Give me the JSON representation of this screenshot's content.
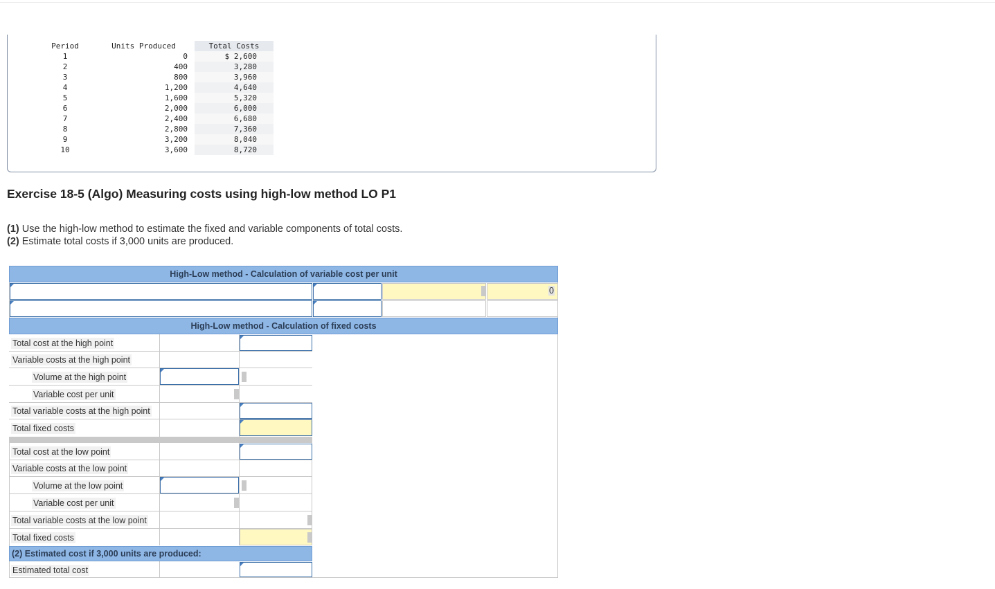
{
  "data_table": {
    "headers": [
      "Period",
      "Units Produced",
      "Total Costs"
    ],
    "rows": [
      [
        "1",
        "0",
        "$ 2,600"
      ],
      [
        "2",
        "400",
        "3,280"
      ],
      [
        "3",
        "800",
        "3,960"
      ],
      [
        "4",
        "1,200",
        "4,640"
      ],
      [
        "5",
        "1,600",
        "5,320"
      ],
      [
        "6",
        "2,000",
        "6,000"
      ],
      [
        "7",
        "2,400",
        "6,680"
      ],
      [
        "8",
        "2,800",
        "7,360"
      ],
      [
        "9",
        "3,200",
        "8,040"
      ],
      [
        "10",
        "3,600",
        "8,720"
      ]
    ]
  },
  "exercise": {
    "title": "Exercise 18-5 (Algo) Measuring costs using high-low method LO P1",
    "line1_num": "(1)",
    "line1_text": " Use the high-low method to estimate the fixed and variable components of total costs.",
    "line2_num": "(2)",
    "line2_text": " Estimate total costs if 3,000 units are produced."
  },
  "worksheet": {
    "variable_header": "High-Low method - Calculation of variable cost per unit",
    "variable_result": "0",
    "fixed_header": "High-Low method - Calculation of fixed costs",
    "high": {
      "total_cost": "Total cost at the high point",
      "variable_costs": "Variable costs at the high point",
      "volume": "Volume at the high point",
      "vcpu": "Variable cost per unit",
      "total_variable": "Total variable costs at the high point",
      "fixed": "Total fixed costs"
    },
    "low": {
      "total_cost": "Total cost at the low point",
      "variable_costs": "Variable costs at the low point",
      "volume": "Volume at the low point",
      "vcpu": "Variable cost per unit",
      "total_variable": "Total variable costs at the low point",
      "fixed": "Total fixed costs"
    },
    "estimate_header": "(2) Estimated cost if 3,000 units are produced:",
    "estimate_label": "Estimated total cost"
  },
  "colors": {
    "header_blue": "#8fb7e6",
    "input_border": "#3a6ea8",
    "answer_yellow": "#fff8c0"
  }
}
